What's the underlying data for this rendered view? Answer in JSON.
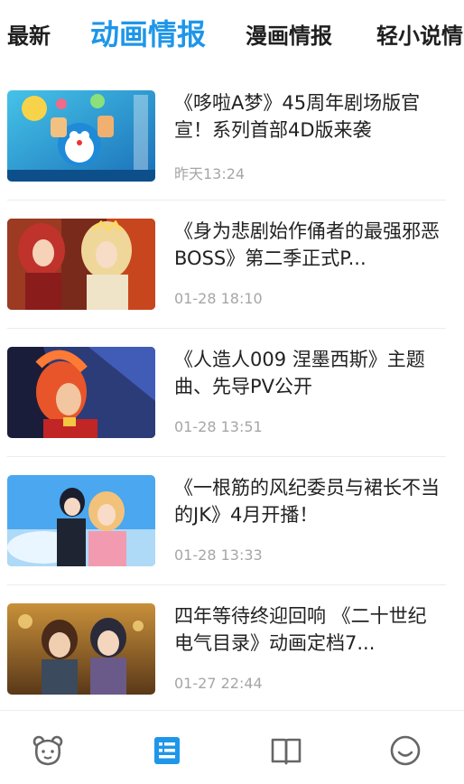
{
  "tabs": [
    {
      "label": "最新"
    },
    {
      "label": "动画情报"
    },
    {
      "label": "漫画情报"
    },
    {
      "label": "轻小说情"
    }
  ],
  "colors": {
    "accent": "#1e96e9",
    "nav_inactive": "#666666",
    "time": "#a6a6a6"
  },
  "articles": [
    {
      "title": "《哆啦A梦》45周年剧场版官宣！系列首部4D版来袭",
      "time": "昨天13:24",
      "thumb_icon": "doraemon-poster-image"
    },
    {
      "title": "《身为悲剧始作俑者的最强邪恶BOSS》第二季正式P...",
      "time": "01-28 18:10",
      "thumb_icon": "villainess-anime-image"
    },
    {
      "title": "《人造人009 涅墨西斯》主题曲、先导PV公开",
      "time": "01-28 13:51",
      "thumb_icon": "cyborg-009-image"
    },
    {
      "title": "《一根筋的风纪委员与裙长不当的JK》4月开播！",
      "time": "01-28 13:33",
      "thumb_icon": "jk-anime-image"
    },
    {
      "title": "四年等待终迎回响 《二十世纪电气目录》动画定档7...",
      "time": "01-27 22:44",
      "thumb_icon": "electric-catalog-image"
    }
  ],
  "bottom_nav": [
    {
      "icon": "bear-face-icon"
    },
    {
      "icon": "news-list-icon",
      "active": true
    },
    {
      "icon": "open-book-icon"
    },
    {
      "icon": "smiley-face-icon"
    }
  ]
}
